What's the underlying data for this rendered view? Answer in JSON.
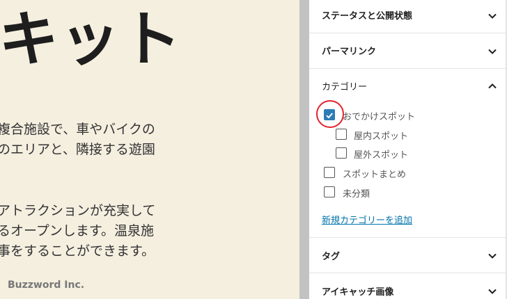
{
  "editor": {
    "title_fragment": "キット",
    "paragraph1": [
      "複合施設で、車やバイクの",
      "のエリアと、隣接する遊園"
    ],
    "paragraph2": [
      "アトラクションが充実して",
      "るオープンします。温泉施",
      "事をすることができます。"
    ],
    "brand": "Buzzword Inc."
  },
  "sidebar": {
    "panels": {
      "status": "ステータスと公開状態",
      "permalink": "パーマリンク",
      "categories": "カテゴリー",
      "tags": "タグ",
      "featured_image": "アイキャッチ画像"
    },
    "categories": [
      {
        "label": "おでかけスポット",
        "checked": true
      },
      {
        "label": "屋内スポット",
        "checked": false
      },
      {
        "label": "屋外スポット",
        "checked": false
      },
      {
        "label": "スポットまとめ",
        "checked": false
      },
      {
        "label": "未分類",
        "checked": false
      }
    ],
    "add_category_link": "新規カテゴリーを追加"
  },
  "icons": {
    "chevron_down": "chevron-down-icon",
    "chevron_up": "chevron-up-icon",
    "check": "check-icon"
  },
  "colors": {
    "accent": "#2c7cb6",
    "highlight": "#e1232d",
    "link": "#0073aa",
    "editor_bg": "#f5efe0"
  }
}
